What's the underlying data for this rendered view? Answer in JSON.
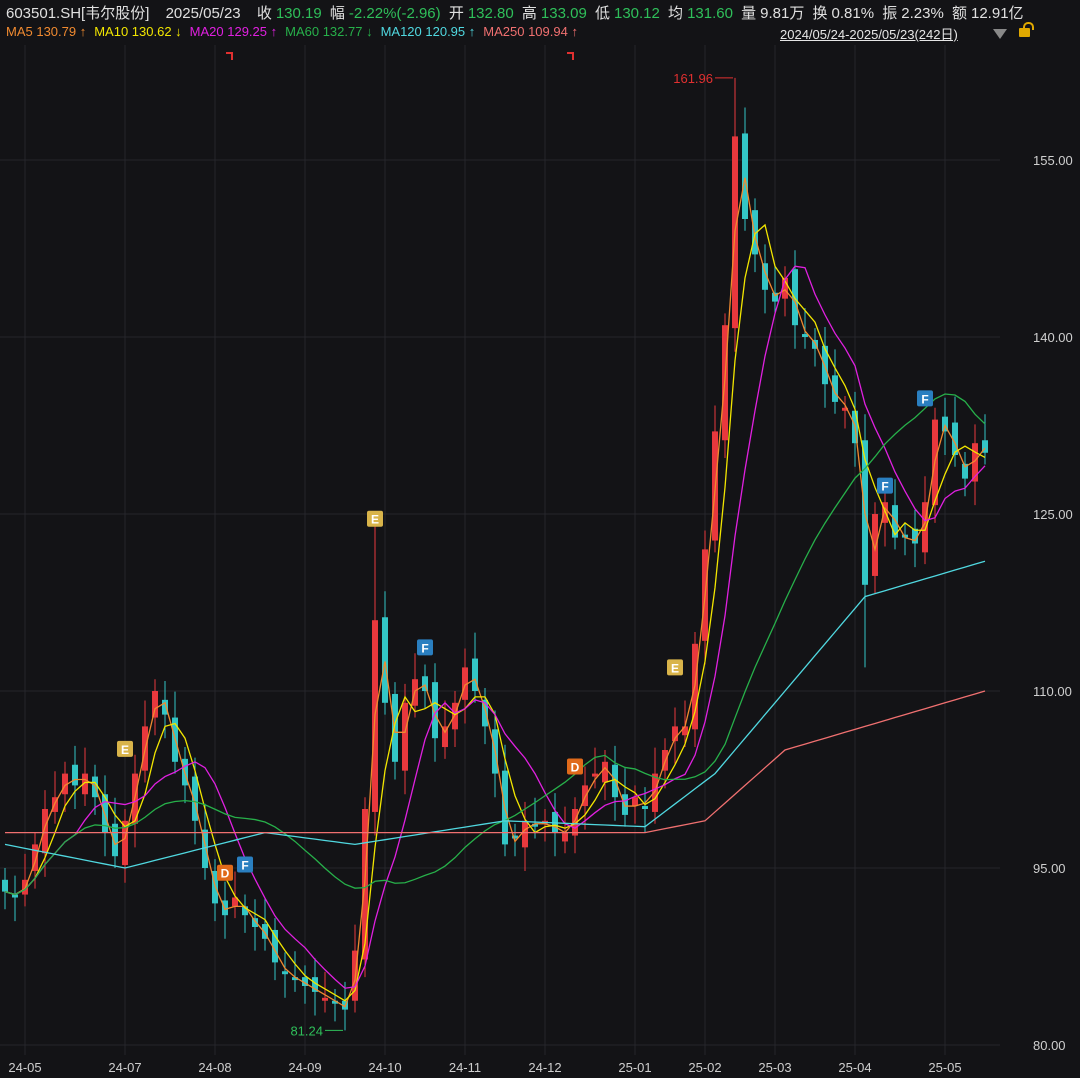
{
  "header": {
    "code": "603501.SH[韦尔股份]",
    "date": "2025/05/23",
    "close_label": "收",
    "close": "130.19",
    "change_label": "幅",
    "change": "-2.22%(-2.96)",
    "open_label": "开",
    "open": "132.80",
    "high_label": "高",
    "high": "133.09",
    "low_label": "低",
    "low": "130.12",
    "avg_label": "均",
    "avg": "131.60",
    "vol_label": "量",
    "vol": "9.81万",
    "turnover_label": "换",
    "turnover": "0.81%",
    "amp_label": "振",
    "amp": "2.23%",
    "amount_label": "额",
    "amount": "12.91亿"
  },
  "ma_legend": [
    {
      "name": "MA5",
      "value": "130.79",
      "arrow": "↑",
      "color": "#f08a30"
    },
    {
      "name": "MA10",
      "value": "130.62",
      "arrow": "↓",
      "color": "#f2e600"
    },
    {
      "name": "MA20",
      "value": "129.25",
      "arrow": "↑",
      "color": "#e020e0"
    },
    {
      "name": "MA60",
      "value": "132.77",
      "arrow": "↓",
      "color": "#27b04a"
    },
    {
      "name": "MA120",
      "value": "120.95",
      "arrow": "↑",
      "color": "#50d8e0"
    },
    {
      "name": "MA250",
      "value": "109.94",
      "arrow": "↑",
      "color": "#f07070"
    }
  ],
  "range": "2024/05/24-2025/05/23(242日)",
  "colors": {
    "up": "#e8383d",
    "down": "#33c6c6",
    "grid": "#26262b",
    "axis_text": "#cfcfcf"
  },
  "chart_data": {
    "type": "candlestick",
    "ylim": [
      80,
      162
    ],
    "yticks": [
      "155.00",
      "140.00",
      "125.00",
      "110.00",
      "95.00",
      "80.00"
    ],
    "ytick_values": [
      155,
      140,
      125,
      110,
      95,
      80
    ],
    "xticks": [
      {
        "label": "24-05",
        "index": 2
      },
      {
        "label": "24-07",
        "index": 12
      },
      {
        "label": "24-08",
        "index": 21
      },
      {
        "label": "24-09",
        "index": 30
      },
      {
        "label": "24-10",
        "index": 38
      },
      {
        "label": "24-11",
        "index": 46
      },
      {
        "label": "24-12",
        "index": 54
      },
      {
        "label": "25-01",
        "index": 63
      },
      {
        "label": "25-02",
        "index": 70
      },
      {
        "label": "25-03",
        "index": 77
      },
      {
        "label": "25-04",
        "index": 85
      },
      {
        "label": "25-05",
        "index": 94
      }
    ],
    "first_open": 94,
    "closes": [
      93,
      92.5,
      94,
      97,
      100,
      101,
      103,
      102,
      103,
      101,
      98,
      96,
      99,
      103,
      107,
      110,
      108,
      104,
      102,
      99,
      95,
      92,
      91,
      92.5,
      91,
      90,
      89,
      87,
      86,
      85.5,
      85,
      84.5,
      84,
      83.5,
      83,
      88,
      100,
      116,
      109,
      104,
      109,
      111,
      110,
      106,
      107,
      109,
      112,
      110,
      107,
      103,
      97,
      97.5,
      99,
      98.5,
      99,
      98,
      98,
      100,
      102,
      103,
      104,
      101,
      99.5,
      101,
      100,
      103,
      105,
      107,
      107,
      114,
      122,
      132,
      141,
      157,
      150,
      147,
      144,
      143,
      145,
      141,
      140,
      139,
      136,
      134.5,
      134,
      131,
      119,
      125,
      126,
      123,
      123,
      122.5,
      126,
      133,
      132,
      130,
      128,
      131,
      130.19
    ],
    "extremes": [
      {
        "index": 73,
        "high": 161.96
      },
      {
        "index": 34,
        "low": 81.24
      },
      {
        "index": 37,
        "high": 124
      },
      {
        "index": 86,
        "low": 112
      }
    ],
    "max_label": "161.96",
    "min_label": "81.24",
    "ma120_anchors": [
      [
        0,
        97
      ],
      [
        12,
        95
      ],
      [
        26,
        98
      ],
      [
        35,
        97
      ],
      [
        50,
        99
      ],
      [
        64,
        98.5
      ],
      [
        71,
        103
      ],
      [
        86,
        118
      ],
      [
        98,
        121
      ]
    ],
    "ma250_anchors": [
      [
        0,
        98
      ],
      [
        64,
        98
      ],
      [
        70,
        99
      ],
      [
        78,
        105
      ],
      [
        90,
        108
      ],
      [
        98,
        110
      ]
    ],
    "markers": [
      {
        "label": "E",
        "index": 12,
        "price": 105.1,
        "color": "#d9b44a"
      },
      {
        "label": "D",
        "index": 22,
        "price": 94.6,
        "color": "#e06a1a"
      },
      {
        "label": "F",
        "index": 24,
        "price": 95.3,
        "color": "#2a7fc0"
      },
      {
        "label": "E",
        "index": 37,
        "price": 124.6,
        "color": "#d9b44a"
      },
      {
        "label": "F",
        "index": 42,
        "price": 113.7,
        "color": "#2a7fc0"
      },
      {
        "label": "D",
        "index": 57,
        "price": 103.6,
        "color": "#e06a1a"
      },
      {
        "label": "E",
        "index": 67,
        "price": 112,
        "color": "#d9b44a"
      },
      {
        "label": "F",
        "index": 88,
        "price": 127.4,
        "color": "#2a7fc0"
      },
      {
        "label": "F",
        "index": 92,
        "price": 134.8,
        "color": "#2a7fc0"
      }
    ]
  }
}
